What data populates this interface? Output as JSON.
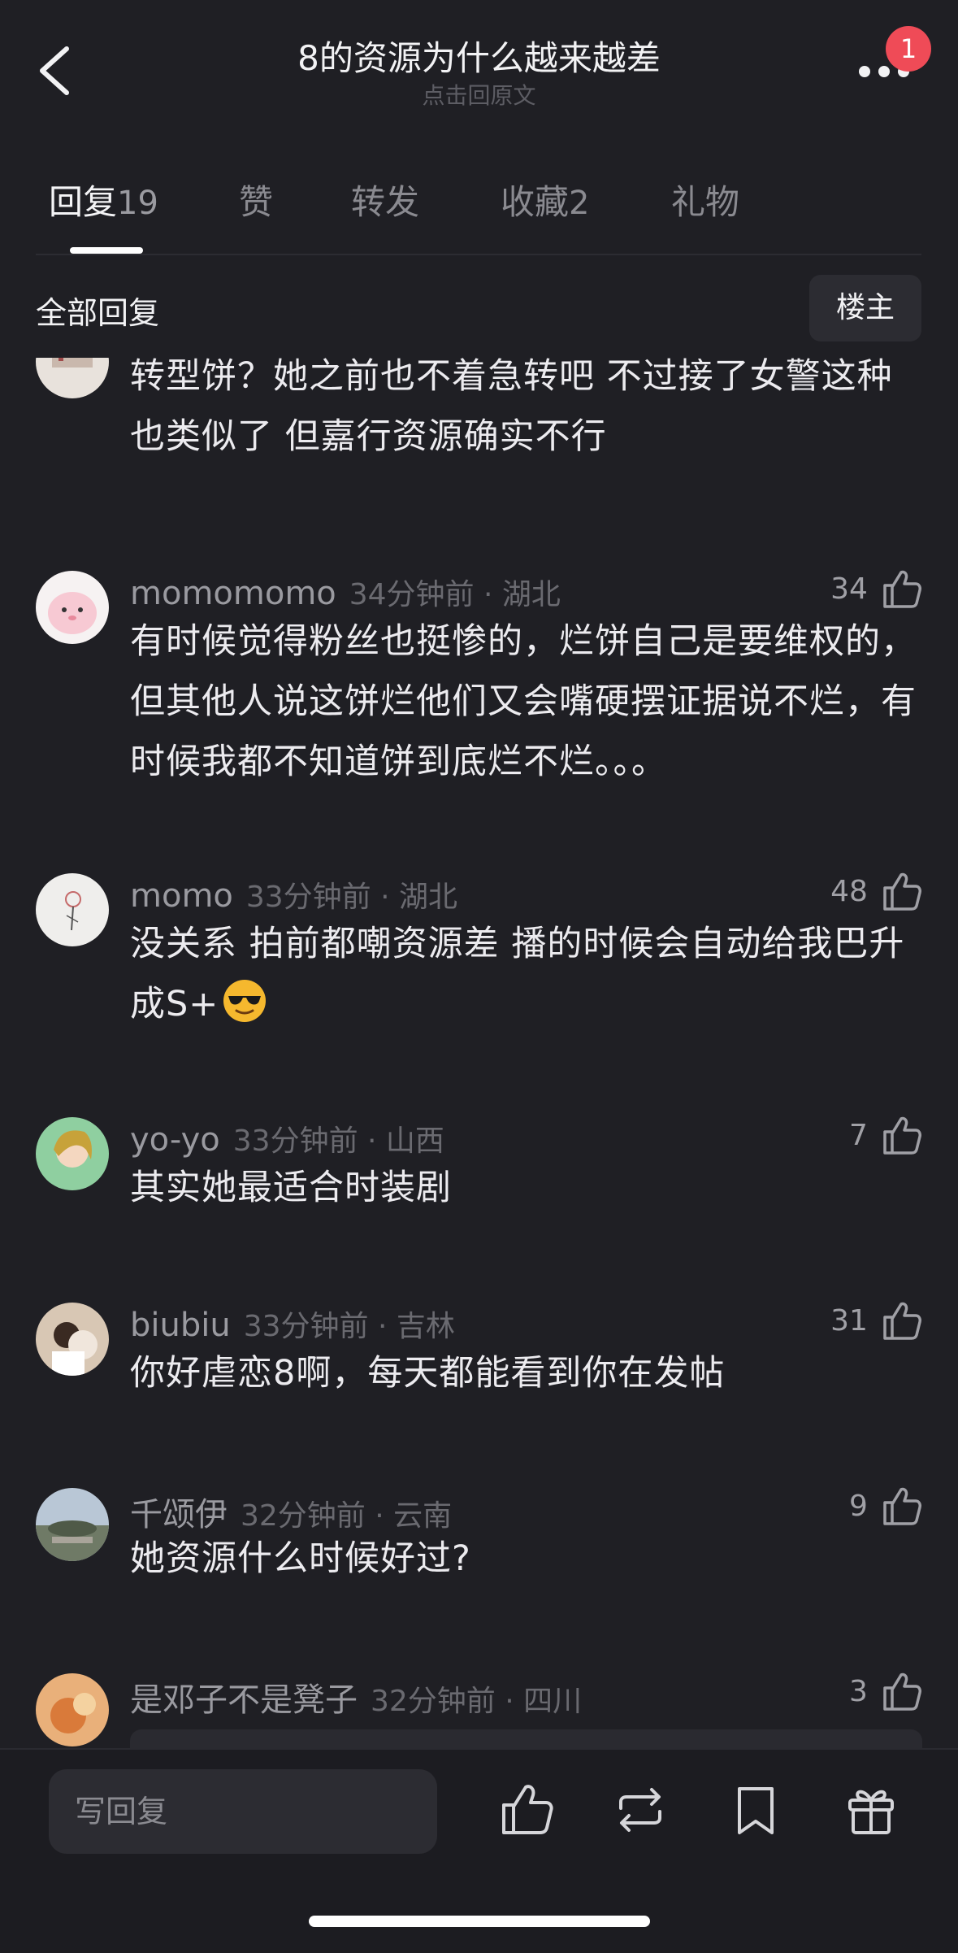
{
  "header": {
    "title": "8的资源为什么越来越差",
    "subtitle": "点击回原文",
    "notification_count": "1"
  },
  "tabs": [
    {
      "label": "回复",
      "count": "19",
      "active": true
    },
    {
      "label": "赞",
      "count": "",
      "active": false
    },
    {
      "label": "转发",
      "count": "",
      "active": false
    },
    {
      "label": "收藏",
      "count": "2",
      "active": false
    },
    {
      "label": "礼物",
      "count": "",
      "active": false
    }
  ],
  "section": {
    "title": "全部回复",
    "op_button": "楼主"
  },
  "comments": [
    {
      "username": "",
      "time_location": "",
      "likes": "",
      "text": "转型饼？她之前也不着急转吧 不过接了女警这种也类似了 但嘉行资源确实不行"
    },
    {
      "username": "momomomo",
      "time_location": "34分钟前 · 湖北",
      "likes": "34",
      "text": "有时候觉得粉丝也挺惨的，烂饼自己是要维权的，但其他人说这饼烂他们又会嘴硬摆证据说不烂，有时候我都不知道饼到底烂不烂。。。"
    },
    {
      "username": "momo",
      "time_location": "33分钟前 · 湖北",
      "likes": "48",
      "text": "没关系 拍前都嘲资源差 播的时候会自动给我巴升成S+",
      "emoji": "sunglasses-emoji"
    },
    {
      "username": "yo-yo",
      "time_location": "33分钟前 · 山西",
      "likes": "7",
      "text": "其实她最适合时装剧"
    },
    {
      "username": "biubiu",
      "time_location": "33分钟前 · 吉林",
      "likes": "31",
      "text": "你好虐恋8啊，每天都能看到你在发帖"
    },
    {
      "username": "千颂伊",
      "time_location": "32分钟前 · 云南",
      "likes": "9",
      "text": "她资源什么时候好过?"
    },
    {
      "username": "是邓子不是凳子",
      "time_location": "32分钟前 · 四川",
      "likes": "3",
      "text": ""
    }
  ],
  "bottom_bar": {
    "reply_placeholder": "写回复",
    "icons": [
      "like-icon",
      "repost-icon",
      "bookmark-icon",
      "gift-icon"
    ]
  },
  "colors": {
    "background": "#1f1f24",
    "badge": "#ef4b57",
    "text_primary": "#ecebef",
    "text_secondary": "#9a9aa0"
  }
}
